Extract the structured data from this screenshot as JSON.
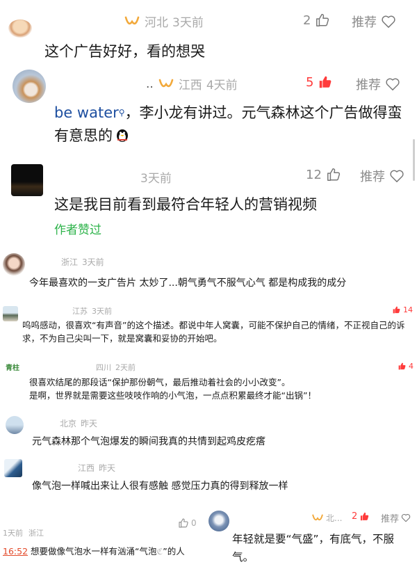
{
  "colors": {
    "accent_green": "#2db34a",
    "like_red": "#ff3b3b",
    "link_blue": "#1e4fa0",
    "meta_gray": "#a9a9a9"
  },
  "comments": [
    {
      "region": "河北",
      "time": "3天前",
      "text": "这个广告好好，看的想哭",
      "likes": "2",
      "recommend": "推荐"
    },
    {
      "prefix": "..",
      "region": "江西",
      "time": "4天前",
      "link": "be water",
      "text": "，李小龙有讲过。元气森林这个广告做得蛮有意思的",
      "emoji_icon": "qq-penguin-icon",
      "likes": "5",
      "recommend": "推荐"
    },
    {
      "time": "3天前",
      "text": "这是我目前看到最符合年轻人的营销视频",
      "author_liked": "作者赞过",
      "likes": "12",
      "recommend": "推荐"
    }
  ],
  "small_comments": [
    {
      "region": "浙江",
      "time": "3天前",
      "text": "今年最喜欢的一支广告片 太妙了...朝气勇气不服气心气 都是构成我的成分"
    },
    {
      "region": "江苏",
      "time": "3天前",
      "likes": "14",
      "text": "呜呜感动，很喜欢“有声音”的这个描述。都说中年人窝囊，可能不保护自己的情绪，不正视自己的诉求，不为自己尖叫一下，就是窝囊和妥协的开始吧。"
    },
    {
      "avatar_text": "青柱",
      "region": "四川",
      "time": "2天前",
      "likes": "4",
      "text1": "很喜欢结尾的那段话“保护那份朝气，最后推动着社会的小小改变”。",
      "text2": "是啊，世界就是需要这些吱吱作响的小气泡，一点点积累最终才能“出锅”！"
    },
    {
      "region": "北京",
      "time": "昨天",
      "text": "元气森林那个气泡爆发的瞬间我真的共情到起鸡皮疙瘩"
    },
    {
      "region": "江西",
      "time": "昨天",
      "text": "像气泡一样喊出来让人很有感触 感觉压力真的得到释放一样"
    }
  ],
  "bottom_left": {
    "time": "1天前",
    "region": "浙江",
    "timestamp": "16:52",
    "text": "想要做像气泡水一样有汹涌“气泡",
    "text_tail": "”的人",
    "likes": "0"
  },
  "bottom_right": {
    "region": "北...",
    "likes": "2",
    "recommend": "推荐",
    "text": "年轻就是要“气盛”，有底气，不服气。"
  }
}
